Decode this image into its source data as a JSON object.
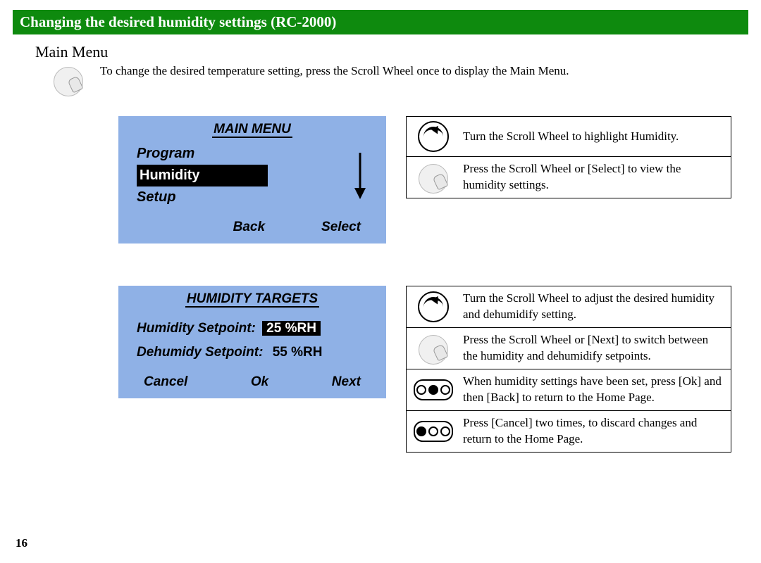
{
  "page_number": "16",
  "title": "Changing the desired humidity settings (RC-2000)",
  "subheading": "Main Menu",
  "intro": "To change the desired temperature setting, press the Scroll Wheel once to display the Main Menu.",
  "screen1": {
    "header": "MAIN MENU",
    "items": [
      "Program",
      "Humidity",
      "Setup"
    ],
    "highlight_index": 1,
    "soft_left": "Back",
    "soft_right": "Select"
  },
  "instr1": [
    {
      "icon": "rotate",
      "text": "Turn the Scroll Wheel to highlight Humidity."
    },
    {
      "icon": "press",
      "text": "Press the Scroll Wheel or [Select] to view the humidity settings."
    }
  ],
  "screen2": {
    "header": "HUMIDITY TARGETS",
    "row1_label": "Humidity Setpoint:",
    "row1_value": "25 %RH",
    "row2_label": "Dehumidy Setpoint:",
    "row2_value": "55 %RH",
    "soft_left": "Cancel",
    "soft_mid": "Ok",
    "soft_right": "Next"
  },
  "instr2": [
    {
      "icon": "rotate",
      "text": "Turn the Scroll Wheel to adjust the desired humidity and dehumidify setting."
    },
    {
      "icon": "press",
      "text": "Press the Scroll Wheel or [Next] to switch between the humidity and dehumidify setpoints."
    },
    {
      "icon": "ok",
      "text": "When humidity settings have been set, press [Ok] and then [Back] to return to the Home Page."
    },
    {
      "icon": "ok2",
      "text": "Press [Cancel] two times, to discard changes and return to the Home Page."
    }
  ]
}
